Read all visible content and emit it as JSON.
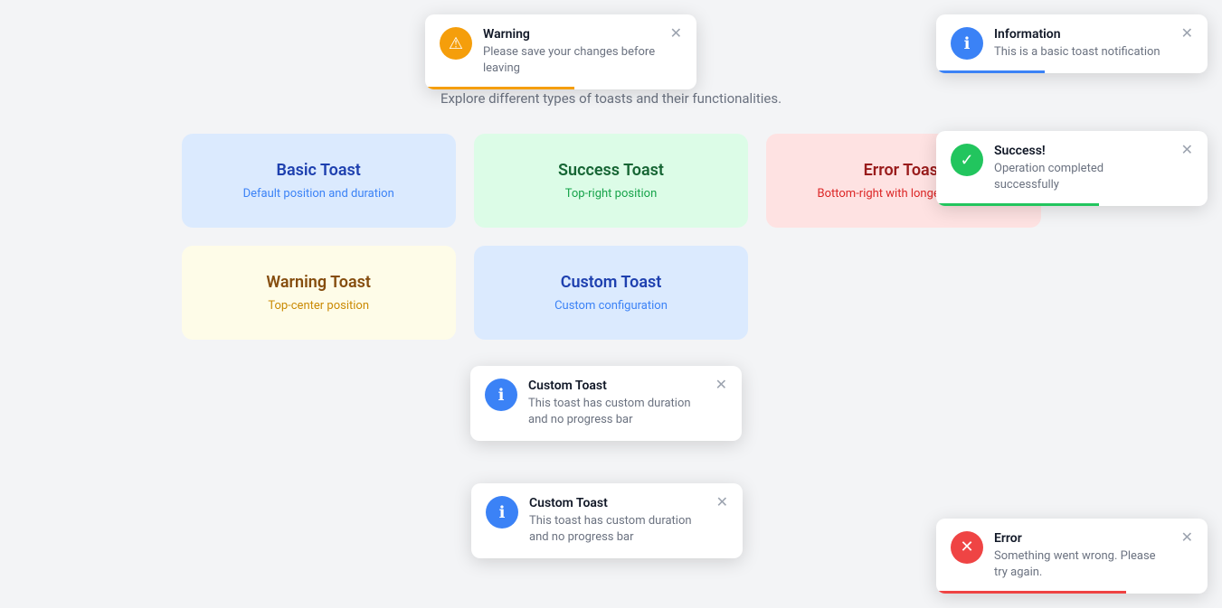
{
  "page": {
    "subtitle": "Explore different types of toasts and their functionalities."
  },
  "cards": [
    {
      "id": "basic-toast",
      "title": "Basic Toast",
      "subtitle": "Default position and duration",
      "theme": "blue"
    },
    {
      "id": "success-toast",
      "title": "Success Toast",
      "subtitle": "Top-right position",
      "theme": "green"
    },
    {
      "id": "error-toast",
      "title": "Error Toast",
      "subtitle": "Bottom-right with longer duration",
      "theme": "red"
    },
    {
      "id": "warning-toast",
      "title": "Warning Toast",
      "subtitle": "Top-center position",
      "theme": "yellow"
    },
    {
      "id": "custom-toast",
      "title": "Custom Toast",
      "subtitle": "Custom configuration",
      "theme": "custom"
    }
  ],
  "toasts": {
    "warning": {
      "title": "Warning",
      "message": "Please save your changes before leaving",
      "progress_color": "#f59e0b",
      "progress_width": "55%"
    },
    "info": {
      "title": "Information",
      "message": "This is a basic toast notification",
      "progress_color": "#3b82f6",
      "progress_width": "40%"
    },
    "success": {
      "title": "Success!",
      "message": "Operation completed successfully",
      "progress_color": "#22c55e",
      "progress_width": "60%"
    },
    "error": {
      "title": "Error",
      "message": "Something went wrong. Please try again.",
      "progress_color": "#ef4444",
      "progress_width": "70%"
    },
    "custom1": {
      "title": "Custom Toast",
      "message": "This toast has custom duration and no progress bar"
    },
    "custom2": {
      "title": "Custom Toast",
      "message": "This toast has custom duration and no progress bar"
    }
  },
  "icons": {
    "close": "✕",
    "warning": "⚠",
    "info": "ℹ",
    "success": "✓",
    "error": "✕"
  }
}
